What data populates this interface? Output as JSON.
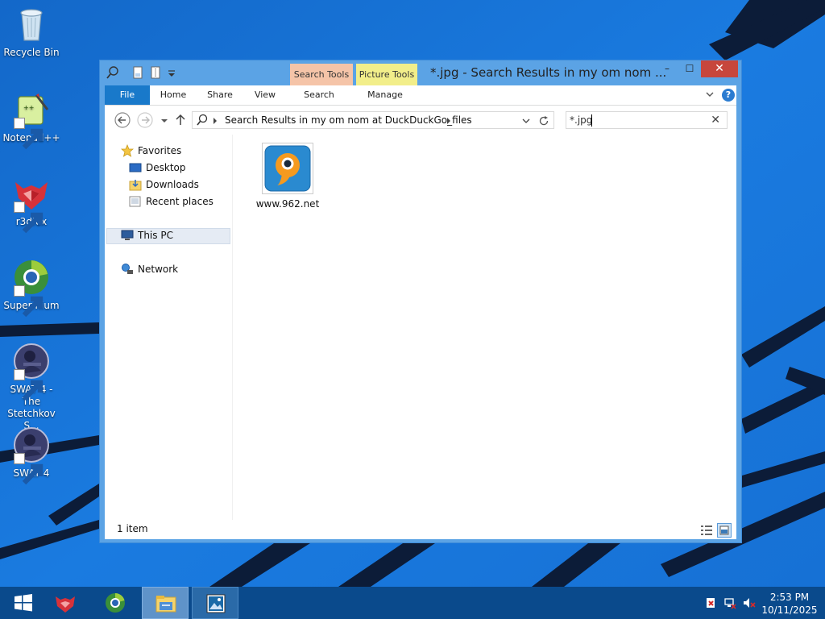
{
  "desktop": {
    "icons": [
      {
        "label": "Recycle Bin"
      },
      {
        "label": "Notepad++"
      },
      {
        "label": "r3dfox"
      },
      {
        "label": "Supermium"
      },
      {
        "label": "SWAT 4 - The Stetchkov S..."
      },
      {
        "label": "SWAT 4"
      }
    ],
    "colors": {
      "background": "#1a73d6",
      "lines": "#0d1b33"
    }
  },
  "window": {
    "title": "*.jpg - Search Results in my om nom ...",
    "context_tabs": {
      "search_tools": "Search Tools",
      "picture_tools": "Picture Tools"
    },
    "controls": {
      "minimize": "–",
      "maximize": "☐",
      "close": "✕"
    },
    "ribbon_tabs": {
      "file": "File",
      "home": "Home",
      "share": "Share",
      "view": "View",
      "search": "Search",
      "manage": "Manage"
    },
    "help": "?",
    "address": "Search Results in my om nom at DuckDuckGo_files",
    "search": {
      "value": "*.jpg"
    },
    "nav_pane": {
      "favorites": "Favorites",
      "desktop": "Desktop",
      "downloads": "Downloads",
      "recent": "Recent places",
      "this_pc": "This PC",
      "network": "Network"
    },
    "files": [
      {
        "name": "www.962.net",
        "icon": "bubble-9-icon"
      }
    ],
    "status": "1 item"
  },
  "taskbar": {
    "clock": {
      "time": "2:53 PM",
      "date": "10/11/2025"
    }
  }
}
